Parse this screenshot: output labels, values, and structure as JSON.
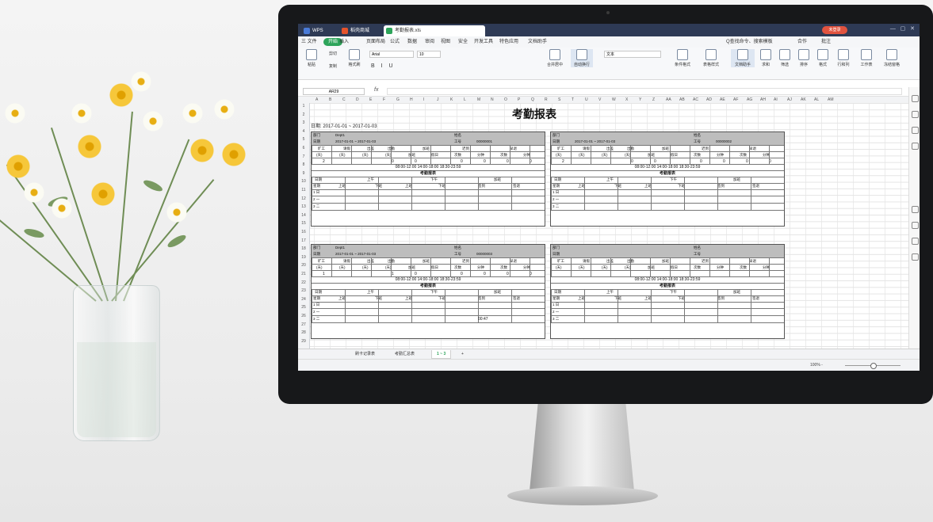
{
  "tabs": {
    "wps": "WPS",
    "daoke": "稻壳商城",
    "doc": "考勤报表.xls"
  },
  "menus": [
    "三 文件",
    "开始",
    "插入",
    "页面布局",
    "公式",
    "数据",
    "审阅",
    "视图",
    "安全",
    "开发工具",
    "特色应用",
    "文档助手"
  ],
  "menu_active_index": 1,
  "toolbar_right": {
    "search": "Q查找命令、搜索模板",
    "share": "合作",
    "comment": "批注",
    "login": "未登录"
  },
  "ribbon": {
    "cut": "剪切",
    "paste": "粘贴",
    "copy": "复制",
    "format_painter": "格式刷",
    "font": "Arial",
    "font_size": "10",
    "merge_center": "合并居中",
    "wrap": "自动换行",
    "number_format": "文本",
    "cond_format": "条件格式",
    "table_style": "表格样式",
    "doc_assistant": "文档助手",
    "sum": "求和",
    "filter": "筛选",
    "sort": "排序",
    "format": "格式",
    "rowcol": "行和列",
    "worksheet": "工作表",
    "freeze": "冻结窗格"
  },
  "formula_bar": {
    "cell_ref": "AR29",
    "fx": "fx",
    "value": ""
  },
  "columns": [
    "A",
    "B",
    "C",
    "D",
    "E",
    "F",
    "G",
    "H",
    "I",
    "J",
    "K",
    "L",
    "M",
    "N",
    "O",
    "P",
    "Q",
    "R",
    "S",
    "T",
    "U",
    "V",
    "W",
    "X",
    "Y",
    "Z",
    "AA",
    "AB",
    "AC",
    "AD",
    "AE",
    "AF",
    "AG",
    "AH",
    "AI",
    "AJ",
    "AK",
    "AL",
    "AM",
    "AN",
    "AO",
    "AP",
    "AQ"
  ],
  "rows": [
    "1",
    "2",
    "3",
    "4",
    "5",
    "6",
    "7",
    "8",
    "9",
    "10",
    "11",
    "12",
    "13",
    "14",
    "15",
    "16",
    "17",
    "18",
    "19",
    "20",
    "21",
    "22",
    "23",
    "24",
    "25",
    "26",
    "27",
    "28",
    "29"
  ],
  "report": {
    "title": "考勤报表",
    "period": "日期: 2017-01-01 ~ 2017-01-03",
    "blocks": [
      {
        "dept_label": "部门",
        "dept": "Dept1",
        "name_label": "姓名",
        "date_label": "日期",
        "date": "2017-01-01 ~ 2017-01-03",
        "id_label": "工号",
        "id": "00000001",
        "counts": [
          "2",
          "",
          "",
          "0",
          "0",
          "",
          "0",
          "0",
          "0",
          "0"
        ],
        "times": "08:00-12:00 14:00-18:00 18:30-23:59",
        "daily": "考勤报表",
        "days": [
          "1 日",
          "2 一",
          "3 二"
        ],
        "extra": ""
      },
      {
        "dept_label": "部门",
        "dept": "",
        "name_label": "姓名",
        "date_label": "日期",
        "date": "2017-01-01 ~ 2017-01-03",
        "id_label": "工号",
        "id": "00000002",
        "counts": [
          "2",
          "",
          "",
          "0",
          "0",
          "",
          "0",
          "0",
          "0",
          "0"
        ],
        "times": "08:00-12:00 14:00-18:00 18:30-23:59",
        "daily": "考勤报表",
        "days": [
          "1 日",
          "2 一",
          "3 二"
        ],
        "extra": ""
      },
      {
        "dept_label": "部门",
        "dept": "Dept1",
        "name_label": "姓名",
        "date_label": "日期",
        "date": "2017-01-01 ~ 2017-01-03",
        "id_label": "工号",
        "id": "00000003",
        "counts": [
          "1",
          "",
          "",
          "1",
          "0",
          "",
          "0",
          "0",
          "0",
          "0"
        ],
        "times": "08:00-12:00 14:00-18:00 18:30-23:59",
        "daily": "考勤报表",
        "days": [
          "1 日",
          "2 一",
          "3 二"
        ],
        "extra": "00:47"
      },
      {
        "dept_label": "部门",
        "dept": "",
        "name_label": "姓名",
        "date_label": "日期",
        "date": "",
        "id_label": "工号",
        "id": "",
        "counts": [
          "",
          "",
          "",
          "",
          "",
          "",
          "",
          "",
          "",
          ""
        ],
        "times": "08:00-12:00 14:00-18:00 18:30-23:59",
        "daily": "考勤报表",
        "days": [
          "1 日",
          "2 一",
          "3 二"
        ],
        "extra": ""
      }
    ],
    "headers": [
      "旷工",
      "请假",
      "出差",
      "出勤",
      "加班",
      "迟到",
      "早退"
    ],
    "subheaders": [
      "(天)",
      "(天)",
      "(天)",
      "(天)",
      "加班",
      "假日",
      "次数",
      "分钟",
      "次数",
      "分钟"
    ],
    "daily_headers": [
      "日期",
      "上午",
      "下午",
      "加班",
      "星期",
      "上班",
      "下班",
      "上班",
      "下班",
      "签到",
      "签退"
    ]
  },
  "sheet_tabs": [
    "刷卡记录表",
    "考勤汇总表",
    "1 ~ 3"
  ],
  "sheet_tab_active": 2,
  "zoom": "100% -"
}
